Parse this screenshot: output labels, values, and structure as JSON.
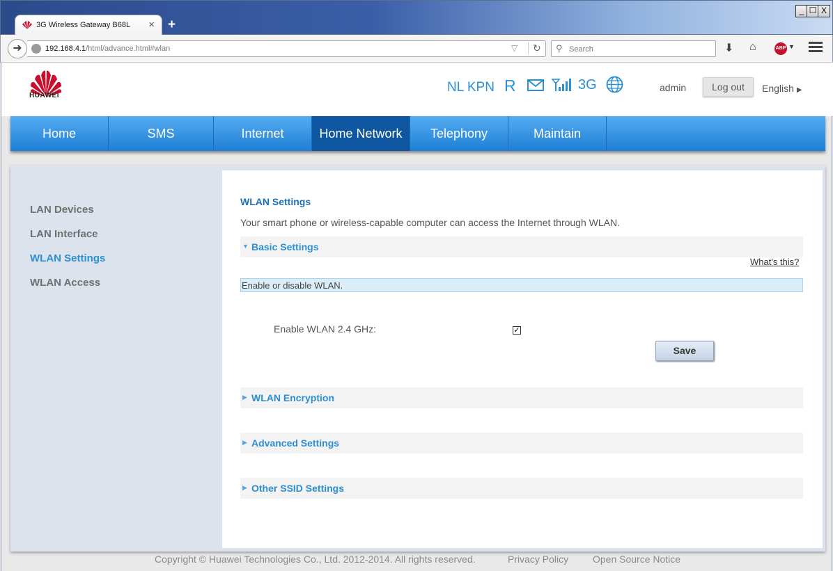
{
  "browser": {
    "tab_title": "3G Wireless Gateway B68L",
    "new_tab": "+",
    "tab_close": "×",
    "url_host": "192.168.4.1",
    "url_path": "/html/advance.html#wlan",
    "search_placeholder": "Search",
    "window_controls": [
      "_",
      "☐",
      "X"
    ]
  },
  "header": {
    "brand": "HUAWEI",
    "operator": "NL KPN",
    "roaming": "R",
    "network_type": "3G",
    "user": "admin",
    "logout_label": "Log out",
    "language": "English"
  },
  "nav": {
    "items": [
      "Home",
      "SMS",
      "Internet",
      "Home Network",
      "Telephony",
      "Maintain"
    ],
    "active": "Home Network"
  },
  "sidebar": {
    "items": [
      "LAN Devices",
      "LAN Interface",
      "WLAN Settings",
      "WLAN Access"
    ],
    "active": "WLAN Settings"
  },
  "main": {
    "title": "WLAN Settings",
    "description": "Your smart phone or wireless-capable computer can access the Internet through WLAN.",
    "basic_settings": "Basic Settings",
    "whats_this": "What's this?",
    "notice": "Enable or disable WLAN.",
    "enable_label": "Enable WLAN 2.4 GHz:",
    "enable_checked": true,
    "save_label": "Save",
    "sections": [
      "WLAN Encryption",
      "Advanced Settings",
      "Other SSID Settings"
    ]
  },
  "footer": {
    "copyright": "Copyright © Huawei Technologies Co., Ltd. 2012-2014. All rights reserved.",
    "privacy": "Privacy Policy",
    "open_source": "Open Source Notice"
  },
  "colors": {
    "accent": "#2b8fd1",
    "nav_active": "#0e57a0",
    "brand_red": "#c8102e"
  }
}
